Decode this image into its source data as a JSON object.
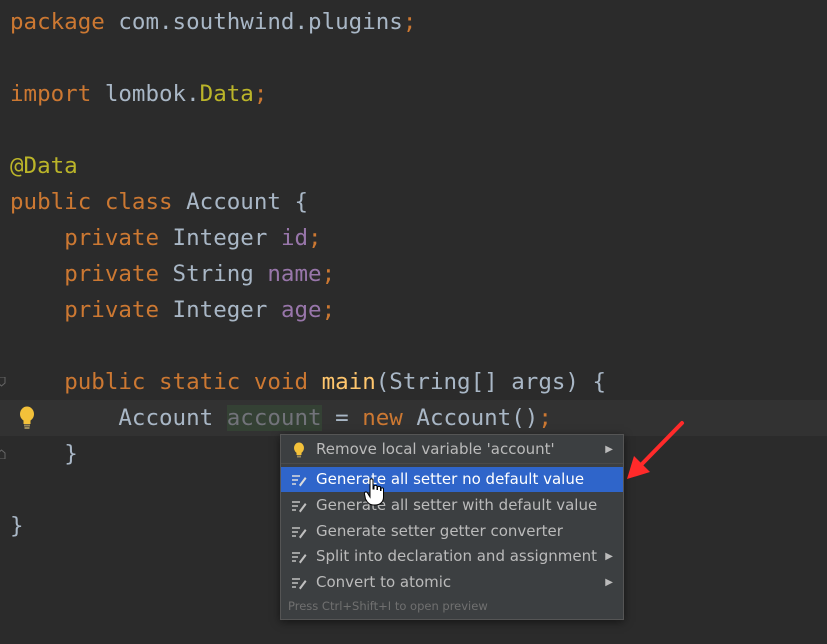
{
  "code": {
    "package_kw": "package",
    "package_name": " com.southwind.plugins",
    "semicolon": ";",
    "import_kw": "import",
    "import_pkg": " lombok.",
    "import_cls": "Data",
    "annotation": "@Data",
    "class_decl_kw": "public class",
    "class_name": " Account {",
    "private_kw": "private",
    "type_integer": " Integer ",
    "type_string": " String ",
    "field_id": "id",
    "field_name": "name",
    "field_age": "age",
    "main_kw": "public static void",
    "main_name": "main",
    "main_params": "(String[] args) {",
    "account_type": "Account ",
    "account_var": "account",
    "assign": " = ",
    "new_kw": "new",
    "ctor": " Account()",
    "close_inner": "}",
    "close_outer": "}"
  },
  "popup": {
    "items": [
      {
        "label": "Remove local variable 'account'",
        "icon": "lightbulb-icon",
        "submenu": true
      },
      {
        "label": "Generate all setter no default value",
        "icon": "generate-icon",
        "submenu": false
      },
      {
        "label": "Generate all setter with default value",
        "icon": "generate-icon",
        "submenu": false
      },
      {
        "label": "Generate setter getter converter",
        "icon": "generate-icon",
        "submenu": false
      },
      {
        "label": "Split into declaration and assignment",
        "icon": "generate-icon",
        "submenu": true
      },
      {
        "label": "Convert to atomic",
        "icon": "generate-icon",
        "submenu": true
      }
    ],
    "selected_index": 1,
    "footer": "Press Ctrl+Shift+I to open preview"
  },
  "colors": {
    "background": "#2b2b2b",
    "keyword": "#cc7832",
    "annotation": "#bbb529",
    "field": "#9876aa",
    "method": "#ffc66d",
    "selection": "#2f65ca",
    "arrow": "#ff2a2a"
  }
}
